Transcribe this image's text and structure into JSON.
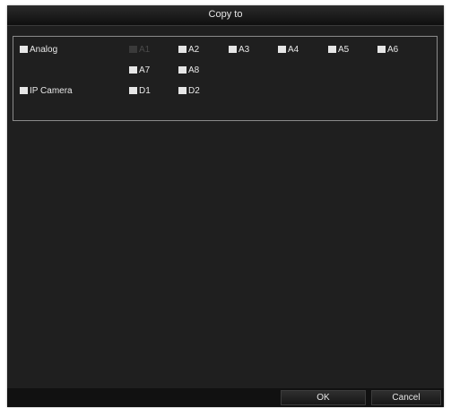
{
  "dialog": {
    "title": "Copy to"
  },
  "analog": {
    "group_label": "Analog",
    "channels": [
      {
        "label": "A1",
        "enabled": false
      },
      {
        "label": "A2",
        "enabled": true
      },
      {
        "label": "A3",
        "enabled": true
      },
      {
        "label": "A4",
        "enabled": true
      },
      {
        "label": "A5",
        "enabled": true
      },
      {
        "label": "A6",
        "enabled": true
      },
      {
        "label": "A7",
        "enabled": true
      },
      {
        "label": "A8",
        "enabled": true
      }
    ]
  },
  "ip_camera": {
    "group_label": "IP Camera",
    "channels": [
      {
        "label": "D1",
        "enabled": true
      },
      {
        "label": "D2",
        "enabled": true
      }
    ]
  },
  "buttons": {
    "ok": "OK",
    "cancel": "Cancel"
  }
}
